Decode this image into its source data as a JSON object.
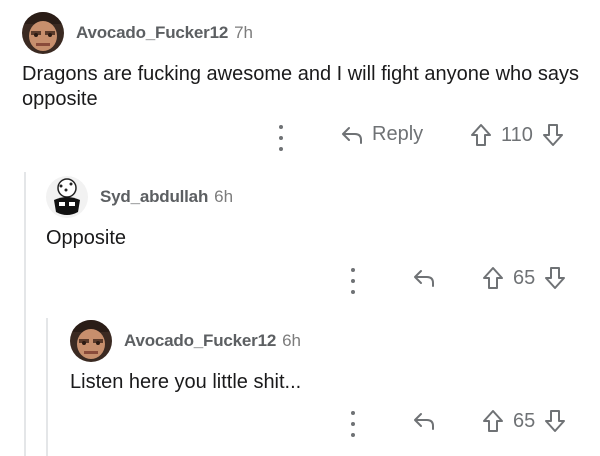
{
  "comments": [
    {
      "username": "Avocado_Fucker12",
      "time": "7h",
      "text": "Dragons are fucking awesome and I will fight anyone who says opposite",
      "reply_label": "Reply",
      "votes": "110",
      "avatar_icon": "face-photo-avatar-icon"
    },
    {
      "username": "Syd_abdullah",
      "time": "6h",
      "text": "Opposite",
      "votes": "65",
      "avatar_icon": "cartoon-avatar-icon"
    },
    {
      "username": "Avocado_Fucker12",
      "time": "6h",
      "text": "Listen here you little shit...",
      "votes": "65",
      "avatar_icon": "face-photo-avatar-icon"
    }
  ],
  "colors": {
    "text": "#1a1a1b",
    "muted": "#6f7275",
    "thread_line": "#e4e6e8"
  }
}
